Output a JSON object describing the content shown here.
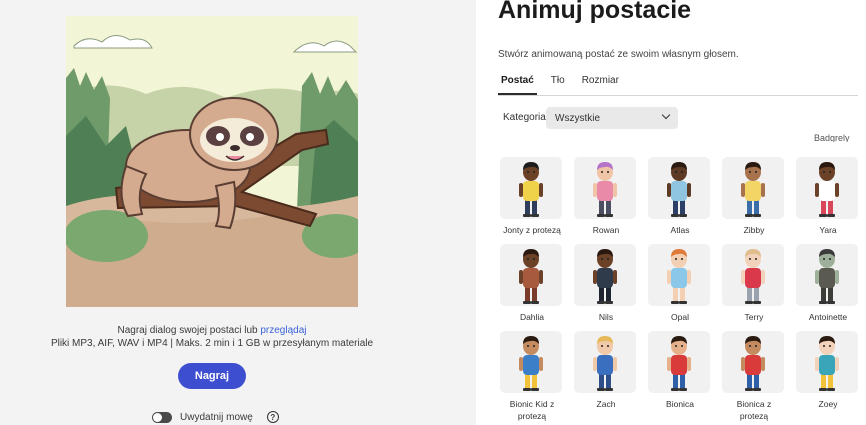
{
  "left": {
    "upload_text": "Nagraj dialog swojej postaci lub",
    "browse_link": "przeglądaj",
    "file_info": "Pliki MP3, AIF, WAV i MP4 | Maks. 2 min i 1 GB w przesyłanym materiale",
    "record_label": "Nagraj",
    "toggle_label": "Uwydatnij mowę",
    "help_icon": "?"
  },
  "right": {
    "title": "Animuj postacie",
    "subtitle": "Stwórz animowaną postać ze swoim własnym głosem.",
    "tabs": [
      "Postać",
      "Tło",
      "Rozmiar"
    ],
    "active_tab": "Postać",
    "category_label": "Kategoria",
    "category_value": "Wszystkie",
    "cut_label": "Badgrely",
    "characters": [
      {
        "name": "Jonty z protezą",
        "skin": "#6b4128",
        "hair": "#1d1d1d",
        "shirt": "#f0d14a",
        "pants": "#2f3e5c"
      },
      {
        "name": "Rowan",
        "skin": "#f0c4a6",
        "hair": "#b374c9",
        "shirt": "#e98aa8",
        "pants": "#4a4f63"
      },
      {
        "name": "Atlas",
        "skin": "#5c3a24",
        "hair": "#2a1a10",
        "shirt": "#8fc5e0",
        "pants": "#2c3f66"
      },
      {
        "name": "Zibby",
        "skin": "#a8734c",
        "hair": "#2b1a12",
        "shirt": "#f2d565",
        "pants": "#3b6ea8"
      },
      {
        "name": "Yara",
        "skin": "#6b4128",
        "hair": "#2a1810",
        "shirt": "#ffffff",
        "pants": "#d9465a"
      },
      {
        "name": "Dahlia",
        "skin": "#6b4128",
        "hair": "#2a1810",
        "shirt": "#a85a3e",
        "pants": "#7a3b2a"
      },
      {
        "name": "Nils",
        "skin": "#6b4128",
        "hair": "#2a1810",
        "shirt": "#2f3a4a",
        "pants": "#1f2530"
      },
      {
        "name": "Opal",
        "skin": "#f3cfb4",
        "hair": "#e07a3a",
        "shirt": "#8ac7e8",
        "pants": "#f3cfb4"
      },
      {
        "name": "Terry",
        "skin": "#f3d2bb",
        "hair": "#e0bd8c",
        "shirt": "#d9394a",
        "pants": "#9aa3ad"
      },
      {
        "name": "Antoinette",
        "skin": "#9fb09a",
        "hair": "#3b3b3b",
        "shirt": "#5a5a52",
        "pants": "#3c3c38"
      },
      {
        "name": "Bionic Kid z protezą",
        "skin": "#c48a60",
        "hair": "#2a1a10",
        "shirt": "#3a7fc8",
        "pants": "#f2c23a"
      },
      {
        "name": "Zach",
        "skin": "#f0c9a8",
        "hair": "#e5b95a",
        "shirt": "#3a6fc0",
        "pants": "#2f4f8a"
      },
      {
        "name": "Bionica",
        "skin": "#e6b08a",
        "hair": "#2a1a10",
        "shirt": "#d93b3b",
        "pants": "#2f5fa8"
      },
      {
        "name": "Bionica z protezą",
        "skin": "#c48a60",
        "hair": "#2a1a10",
        "shirt": "#d93b3b",
        "pants": "#2f5fa8"
      },
      {
        "name": "Zoey",
        "skin": "#f3d2bb",
        "hair": "#2a1a10",
        "shirt": "#3aa4b8",
        "pants": "#f2c23a"
      }
    ]
  }
}
